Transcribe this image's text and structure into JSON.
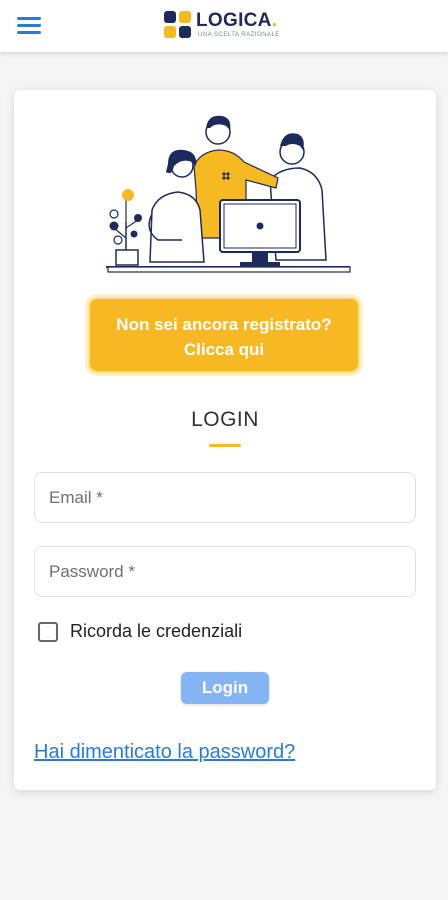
{
  "header": {
    "menu_icon": "hamburger-menu-icon",
    "logo": {
      "name": "LOGICA",
      "dot": ".",
      "tagline": "UNA SCELTA RAZIONALE",
      "colors": {
        "navy": "#1d2a5c",
        "yellow": "#f5b921",
        "blue": "#2b7bd6"
      }
    }
  },
  "card": {
    "illustration": "team-at-computer-illustration",
    "register_line1": "Non sei ancora registrato?",
    "register_line2": "Clicca qui",
    "title": "LOGIN",
    "email_placeholder": "Email *",
    "password_placeholder": "Password *",
    "remember_label": "Ricorda le credenziali",
    "remember_checked": false,
    "login_label": "Login",
    "forgot_link": "Hai dimenticato la password?"
  },
  "colors": {
    "accent_yellow": "#f7b824",
    "login_button": "#84b4f3",
    "link_blue": "#2b7bd6",
    "background": "#f5f5f6"
  }
}
